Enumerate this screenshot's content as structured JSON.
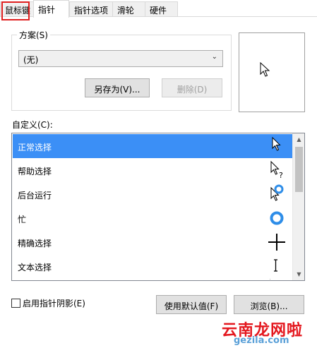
{
  "tabs": [
    {
      "label": "鼠标键",
      "active": false
    },
    {
      "label": "指针",
      "active": true
    },
    {
      "label": "指针选项",
      "active": false
    },
    {
      "label": "滑轮",
      "active": false
    },
    {
      "label": "硬件",
      "active": false
    }
  ],
  "scheme": {
    "group_label": "方案(S)",
    "selected_value": "(无)",
    "save_as_label": "另存为(V)...",
    "delete_label": "删除(D)"
  },
  "customize": {
    "label": "自定义(C):",
    "items": [
      {
        "label": "正常选择",
        "cursor_icon": "arrow-cursor-icon",
        "selected": true
      },
      {
        "label": "帮助选择",
        "cursor_icon": "help-cursor-icon",
        "selected": false
      },
      {
        "label": "后台运行",
        "cursor_icon": "working-in-background-cursor-icon",
        "selected": false
      },
      {
        "label": "忙",
        "cursor_icon": "busy-cursor-icon",
        "selected": false
      },
      {
        "label": "精确选择",
        "cursor_icon": "crosshair-cursor-icon",
        "selected": false
      },
      {
        "label": "文本选择",
        "cursor_icon": "text-cursor-icon",
        "selected": false
      }
    ]
  },
  "options": {
    "shadow_checkbox_label": "启用指针阴影(E)",
    "shadow_checked": false
  },
  "buttons": {
    "use_default_label": "使用默认值(F)",
    "browse_label": "浏览(B)..."
  },
  "watermark": {
    "text": "云南龙网",
    "suffix": "啦",
    "url": "gezila.com"
  },
  "colors": {
    "selection": "#3b8ff6",
    "highlight_frame": "#e02020",
    "busy_ring": "#2e8de8"
  }
}
